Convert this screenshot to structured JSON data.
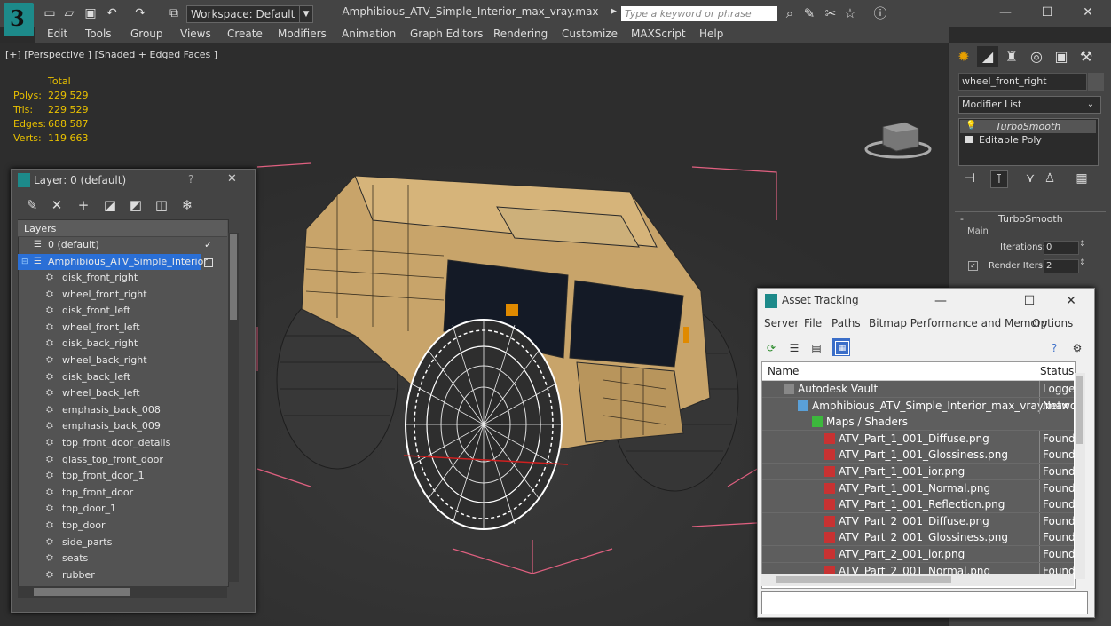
{
  "titlebar": {
    "workspace_label": "Workspace: Default",
    "document_title": "Amphibious_ATV_Simple_Interior_max_vray.max",
    "search_placeholder": "Type a keyword or phrase",
    "minimize": "—",
    "maximize": "☐",
    "close": "✕"
  },
  "menu": [
    "Edit",
    "Tools",
    "Group",
    "Views",
    "Create",
    "Modifiers",
    "Animation",
    "Graph Editors",
    "Rendering",
    "Customize",
    "MAXScript",
    "Help"
  ],
  "viewport": {
    "label": "[+] [Perspective ] [Shaded + Edged Faces ]",
    "stats": {
      "header": "Total",
      "rows": [
        {
          "label": "Polys:",
          "value": "229 529"
        },
        {
          "label": "Tris:",
          "value": "229 529"
        },
        {
          "label": "Edges:",
          "value": "688 587"
        },
        {
          "label": "Verts:",
          "value": "119 663"
        }
      ]
    }
  },
  "command_panel": {
    "object_name": "wheel_front_right",
    "modifier_list_label": "Modifier List",
    "stack": [
      "TurboSmooth",
      "Editable Poly"
    ],
    "rollout_title": "TurboSmooth",
    "group_main": "Main",
    "iterations_label": "Iterations:",
    "iterations_value": "0",
    "render_iters_label": "Render Iters:",
    "render_iters_value": "2",
    "accent_color": "#e8a000"
  },
  "layer_window": {
    "title": "Layer: 0 (default)",
    "help": "?",
    "close": "✕",
    "column_header": "Layers",
    "layers": [
      {
        "name": "0 (default)",
        "kind": "layer"
      },
      {
        "name": "Amphibious_ATV_Simple_Interior",
        "kind": "layer-selected"
      }
    ],
    "objects": [
      "disk_front_right",
      "wheel_front_right",
      "disk_front_left",
      "wheel_front_left",
      "disk_back_right",
      "wheel_back_right",
      "disk_back_left",
      "wheel_back_left",
      "emphasis_back_008",
      "emphasis_back_009",
      "top_front_door_details",
      "glass_top_front_door",
      "top_front_door_1",
      "top_front_door",
      "top_door_1",
      "top_door",
      "side_parts",
      "seats",
      "rubber"
    ]
  },
  "asset_window": {
    "title": "Asset Tracking",
    "menu": [
      "Server",
      "File",
      "Paths",
      "Bitmap Performance and Memory",
      "Options"
    ],
    "columns": {
      "name": "Name",
      "status": "Status"
    },
    "rows": [
      {
        "name": "Autodesk Vault",
        "status": "Logged",
        "indent": 1,
        "icon": "vault"
      },
      {
        "name": "Amphibious_ATV_Simple_Interior_max_vray.max",
        "status": "Networ",
        "indent": 2,
        "icon": "max"
      },
      {
        "name": "Maps / Shaders",
        "status": "",
        "indent": 3,
        "icon": "maps"
      },
      {
        "name": "ATV_Part_1_001_Diffuse.png",
        "status": "Found",
        "indent": 4,
        "icon": "png"
      },
      {
        "name": "ATV_Part_1_001_Glossiness.png",
        "status": "Found",
        "indent": 4,
        "icon": "png"
      },
      {
        "name": "ATV_Part_1_001_ior.png",
        "status": "Found",
        "indent": 4,
        "icon": "png"
      },
      {
        "name": "ATV_Part_1_001_Normal.png",
        "status": "Found",
        "indent": 4,
        "icon": "png"
      },
      {
        "name": "ATV_Part_1_001_Reflection.png",
        "status": "Found",
        "indent": 4,
        "icon": "png"
      },
      {
        "name": "ATV_Part_2_001_Diffuse.png",
        "status": "Found",
        "indent": 4,
        "icon": "png"
      },
      {
        "name": "ATV_Part_2_001_Glossiness.png",
        "status": "Found",
        "indent": 4,
        "icon": "png"
      },
      {
        "name": "ATV_Part_2_001_ior.png",
        "status": "Found",
        "indent": 4,
        "icon": "png"
      },
      {
        "name": "ATV_Part_2_001_Normal.png",
        "status": "Found",
        "indent": 4,
        "icon": "png"
      }
    ]
  }
}
